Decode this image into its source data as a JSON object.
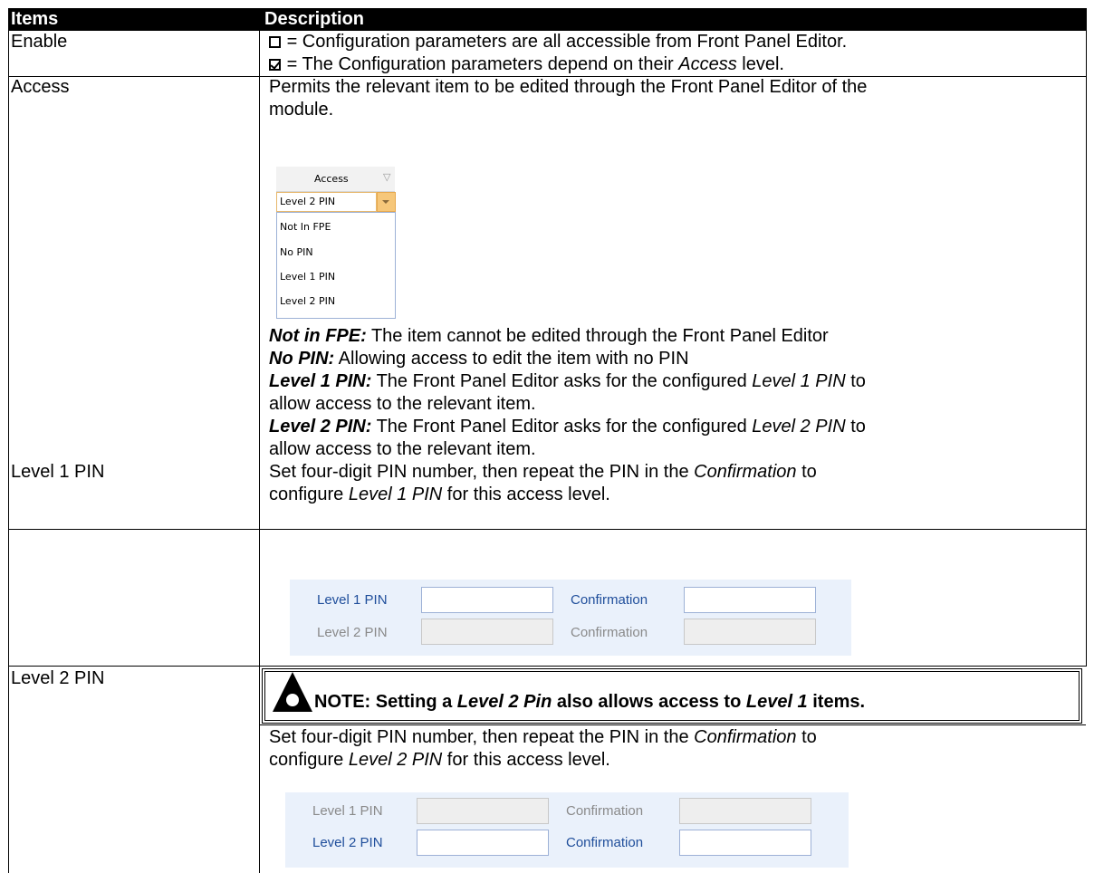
{
  "header": {
    "items": "Items",
    "description": "Description"
  },
  "enable": {
    "item": "Enable",
    "line1_text": "= Configuration parameters are all accessible from Front Panel Editor.",
    "line2_pre": "= The Configuration parameters depend on their ",
    "line2_italic": "Access",
    "line2_post": " level."
  },
  "access": {
    "item": "Access",
    "line1": "Permits the relevant item to be edited through the Front Panel Editor of the",
    "line2": "module.",
    "dropdown": {
      "header": "Access",
      "selected": "Level 2 PIN",
      "options": [
        "Not In FPE",
        "No PIN",
        "Level 1 PIN",
        "Level 2 PIN"
      ]
    },
    "defs": {
      "nfpe_term": "Not in FPE:",
      "nfpe_text": " The item cannot be edited through the Front Panel Editor",
      "nopin_term": "No PIN:",
      "nopin_text": " Allowing access to edit the item with no PIN",
      "l1_term": "Level 1 PIN:",
      "l1_text_a": " The Front Panel Editor asks for the configured ",
      "l1_text_it": "Level 1 PIN",
      "l1_text_b": " to",
      "l1_text_c": "allow access to the relevant item.",
      "l2_term": "Level 2 PIN:",
      "l2_text_a": " The Front Panel Editor asks for the configured ",
      "l2_text_it": "Level 2 PIN",
      "l2_text_b": " to",
      "l2_text_c": "allow access to the relevant item."
    }
  },
  "level1": {
    "item": "Level 1 PIN",
    "l1_a": "Set four-digit PIN number, then repeat the PIN in the ",
    "l1_it": "Confirmation",
    "l1_b": " to",
    "l2_a": "configure ",
    "l2_it": "Level 1 PIN",
    "l2_b": " for this access level.",
    "panel": {
      "level1_label": "Level 1 PIN",
      "level2_label": "Level 2 PIN",
      "confirm_label": "Confirmation"
    }
  },
  "level2": {
    "item": "Level 2 PIN",
    "note_a": "NOTE: Setting a ",
    "note_it1": "Level 2 Pin",
    "note_b": " also allows access to ",
    "note_it2": "Level 1",
    "note_c": " items.",
    "l1_a": "Set four-digit PIN number, then repeat the PIN in the ",
    "l1_it": "Confirmation",
    "l1_b": " to",
    "l2_a": "configure ",
    "l2_it": "Level 2 PIN",
    "l2_b": " for this access level.",
    "panel": {
      "level1_label": "Level 1 PIN",
      "level2_label": "Level 2 PIN",
      "confirm_label": "Confirmation"
    }
  }
}
